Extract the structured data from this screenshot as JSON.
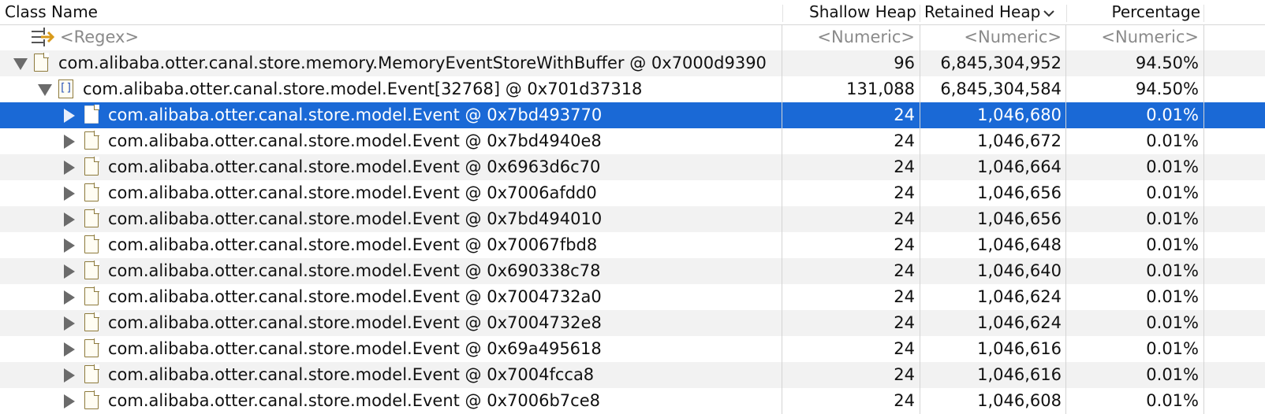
{
  "columns": {
    "class_name": "Class Name",
    "shallow_heap": "Shallow Heap",
    "retained_heap": "Retained Heap",
    "sort_indicator": "chevron-down-icon",
    "percentage": "Percentage"
  },
  "filter_row": {
    "class_name": "<Regex>",
    "shallow_heap": "<Numeric>",
    "retained_heap": "<Numeric>",
    "percentage": "<Numeric>"
  },
  "rows": [
    {
      "label": "com.alibaba.otter.canal.store.memory.MemoryEventStoreWithBuffer @ 0x7000d9390",
      "shallow": "96",
      "retained": "6,845,304,952",
      "percent": "94.50%",
      "icon": "file-icon",
      "expand": "down",
      "level": 0
    },
    {
      "label": "com.alibaba.otter.canal.store.model.Event[32768] @ 0x701d37318",
      "shallow": "131,088",
      "retained": "6,845,304,584",
      "percent": "94.50%",
      "icon": "array-icon",
      "expand": "down",
      "level": 1
    },
    {
      "label": "com.alibaba.otter.canal.store.model.Event @ 0x7bd493770",
      "shallow": "24",
      "retained": "1,046,680",
      "percent": "0.01%",
      "icon": "file-icon",
      "expand": "right",
      "level": 2,
      "selected": true
    },
    {
      "label": "com.alibaba.otter.canal.store.model.Event @ 0x7bd4940e8",
      "shallow": "24",
      "retained": "1,046,672",
      "percent": "0.01%",
      "icon": "file-icon",
      "expand": "right",
      "level": 2
    },
    {
      "label": "com.alibaba.otter.canal.store.model.Event @ 0x6963d6c70",
      "shallow": "24",
      "retained": "1,046,664",
      "percent": "0.01%",
      "icon": "file-icon",
      "expand": "right",
      "level": 2
    },
    {
      "label": "com.alibaba.otter.canal.store.model.Event @ 0x7006afdd0",
      "shallow": "24",
      "retained": "1,046,656",
      "percent": "0.01%",
      "icon": "file-icon",
      "expand": "right",
      "level": 2
    },
    {
      "label": "com.alibaba.otter.canal.store.model.Event @ 0x7bd494010",
      "shallow": "24",
      "retained": "1,046,656",
      "percent": "0.01%",
      "icon": "file-icon",
      "expand": "right",
      "level": 2
    },
    {
      "label": "com.alibaba.otter.canal.store.model.Event @ 0x70067fbd8",
      "shallow": "24",
      "retained": "1,046,648",
      "percent": "0.01%",
      "icon": "file-icon",
      "expand": "right",
      "level": 2
    },
    {
      "label": "com.alibaba.otter.canal.store.model.Event @ 0x690338c78",
      "shallow": "24",
      "retained": "1,046,640",
      "percent": "0.01%",
      "icon": "file-icon",
      "expand": "right",
      "level": 2
    },
    {
      "label": "com.alibaba.otter.canal.store.model.Event @ 0x7004732a0",
      "shallow": "24",
      "retained": "1,046,624",
      "percent": "0.01%",
      "icon": "file-icon",
      "expand": "right",
      "level": 2
    },
    {
      "label": "com.alibaba.otter.canal.store.model.Event @ 0x7004732e8",
      "shallow": "24",
      "retained": "1,046,624",
      "percent": "0.01%",
      "icon": "file-icon",
      "expand": "right",
      "level": 2
    },
    {
      "label": "com.alibaba.otter.canal.store.model.Event @ 0x69a495618",
      "shallow": "24",
      "retained": "1,046,616",
      "percent": "0.01%",
      "icon": "file-icon",
      "expand": "right",
      "level": 2
    },
    {
      "label": "com.alibaba.otter.canal.store.model.Event @ 0x7004fcca8",
      "shallow": "24",
      "retained": "1,046,616",
      "percent": "0.01%",
      "icon": "file-icon",
      "expand": "right",
      "level": 2
    },
    {
      "label": "com.alibaba.otter.canal.store.model.Event @ 0x7006b7ce8",
      "shallow": "24",
      "retained": "1,046,608",
      "percent": "0.01%",
      "icon": "file-icon",
      "expand": "right",
      "level": 2
    }
  ],
  "colors": {
    "selection": "#1a69d6",
    "alt_row": "#f2f2f2",
    "grid": "#d4d4d4"
  }
}
